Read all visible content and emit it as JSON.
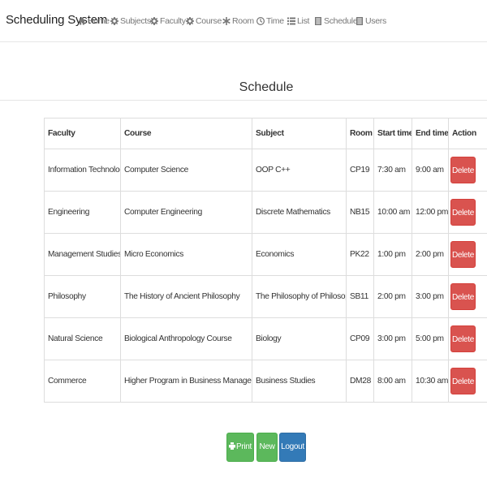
{
  "brand": "Scheduling System",
  "nav": [
    {
      "label": "Home",
      "icon": "home-icon"
    },
    {
      "label": "Subjects",
      "icon": "gear-icon"
    },
    {
      "label": "Faculty",
      "icon": "gear-icon"
    },
    {
      "label": "Course",
      "icon": "gear-icon"
    },
    {
      "label": "Room",
      "icon": "asterisk-icon"
    },
    {
      "label": "Time",
      "icon": "clock-icon"
    },
    {
      "label": "List",
      "icon": "list-icon"
    },
    {
      "label": "Schedule",
      "icon": "schedule-icon"
    },
    {
      "label": "Users",
      "icon": "users-icon"
    }
  ],
  "page_title": "Schedule",
  "table": {
    "headers": [
      "Faculty",
      "Course",
      "Subject",
      "Room",
      "Start time",
      "End time",
      "Action"
    ],
    "rows": [
      [
        "Information Technology",
        "Computer Science",
        "OOP C++",
        "CP19",
        "7:30 am",
        "9:00 am"
      ],
      [
        "Engineering",
        "Computer Engineering",
        "Discrete Mathematics",
        "NB15",
        "10:00 am",
        "12:00 pm"
      ],
      [
        "Management Studies",
        "Micro Economics",
        "Economics",
        "PK22",
        "1:00 pm",
        "2:00 pm"
      ],
      [
        "Philosophy",
        "The History of Ancient Philosophy",
        "The Philosophy of Philosophy",
        "SB11",
        "2:00 pm",
        "3:00 pm"
      ],
      [
        "Natural Science",
        "Biological Anthropology Course",
        "Biology",
        "CP09",
        "3:00 pm",
        "5:00 pm"
      ],
      [
        "Commerce",
        "Higher Program in Business Management",
        "Business Studies",
        "DM28",
        "8:00 am",
        "10:30 am"
      ]
    ],
    "delete_label": "Delete"
  },
  "buttons": {
    "print": "Print",
    "new": "New",
    "logout": "Logout"
  },
  "colors": {
    "delete": "#d9534f",
    "success": "#5cb85c",
    "primary": "#337ab7"
  }
}
